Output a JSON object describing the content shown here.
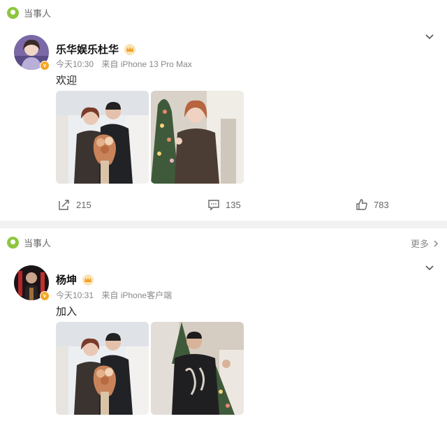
{
  "posts": [
    {
      "label": "当事人",
      "user": "乐华娱乐杜华",
      "time": "今天10:30",
      "source": "来自 iPhone 13 Pro Max",
      "text": "欢迎",
      "repost_count": "215",
      "comment_count": "135",
      "like_count": "783"
    },
    {
      "label": "当事人",
      "more_label": "更多",
      "user": "杨坤",
      "time": "今天10:31",
      "source": "来自 iPhone客户端",
      "text": "加入"
    }
  ],
  "colors": {
    "badge_verified": "#f5a623",
    "label_pin": "#8ec63f",
    "divider": "#f2f2f2"
  },
  "icons": [
    "location-pin-icon",
    "chevron-down-icon",
    "crown-icon",
    "verified-badge-icon",
    "repost-icon",
    "comment-icon",
    "like-icon",
    "chevron-right-icon"
  ]
}
